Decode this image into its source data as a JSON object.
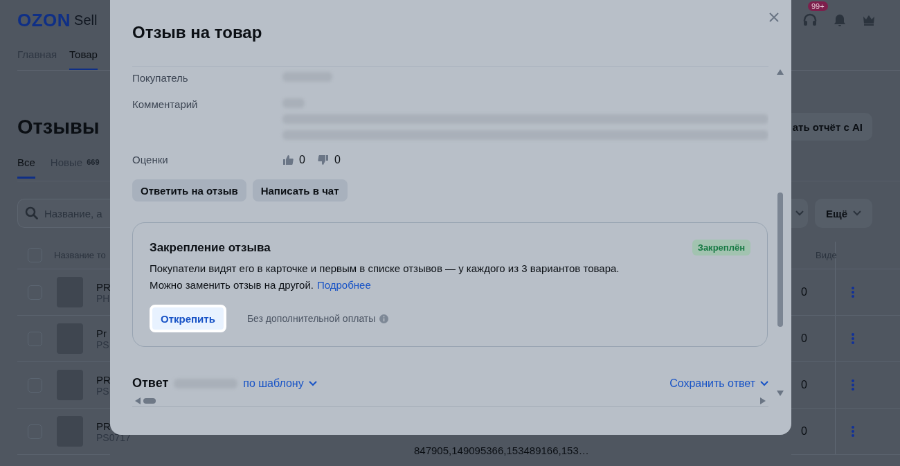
{
  "background": {
    "logo": {
      "brand": "OZON",
      "suffix": "Sell"
    },
    "nav": [
      {
        "label": "Главная",
        "selected": false
      },
      {
        "label": "Товар",
        "selected": true
      }
    ],
    "page_title": "Отзывы",
    "tabs": [
      {
        "label": "Все",
        "selected": true
      },
      {
        "label": "Новые",
        "count": "669",
        "selected": false
      }
    ],
    "search": {
      "placeholder": "Название, а"
    },
    "support_badge": "99+",
    "report_button": "ать отчёт с AI",
    "more_button": "Ещё",
    "table": {
      "columns": [
        "Название то",
        "Виде"
      ],
      "all_checked": false,
      "rows": [
        {
          "name": "PR",
          "sku": "PH",
          "value": "0",
          "checked": false
        },
        {
          "name": "Pr",
          "sku": "PS",
          "value": "0",
          "checked": false
        },
        {
          "name": "PR",
          "sku": "PS",
          "value": "0",
          "checked": false
        },
        {
          "name": "PR",
          "sku": "PS0717",
          "value": "0",
          "checked": false,
          "ids": "847905,149095366,153489166,153…"
        }
      ]
    }
  },
  "modal": {
    "title": "Отзыв на товар",
    "fields": [
      {
        "label": "Покупатель",
        "kind": "blurred_line"
      },
      {
        "label": "Комментарий",
        "kind": "blurred_paragraph"
      },
      {
        "label": "Оценки",
        "kind": "votes",
        "likes": "0",
        "dislikes": "0"
      }
    ],
    "actions": [
      "Ответить на отзыв",
      "Написать в чат"
    ],
    "pin_card": {
      "title": "Закрепление отзыва",
      "status": "Закреплён",
      "text": "Покупатели видят его в карточке и первым в списке отзывов — у каждого из 3 вариантов товара.",
      "text2": "Можно заменить отзыв на другой.",
      "link": "Подробнее",
      "button": "Открепить",
      "note": "Без дополнительной оплаты"
    },
    "reply": {
      "label": "Ответ",
      "template": "по шаблону",
      "save": "Сохранить ответ"
    }
  }
}
